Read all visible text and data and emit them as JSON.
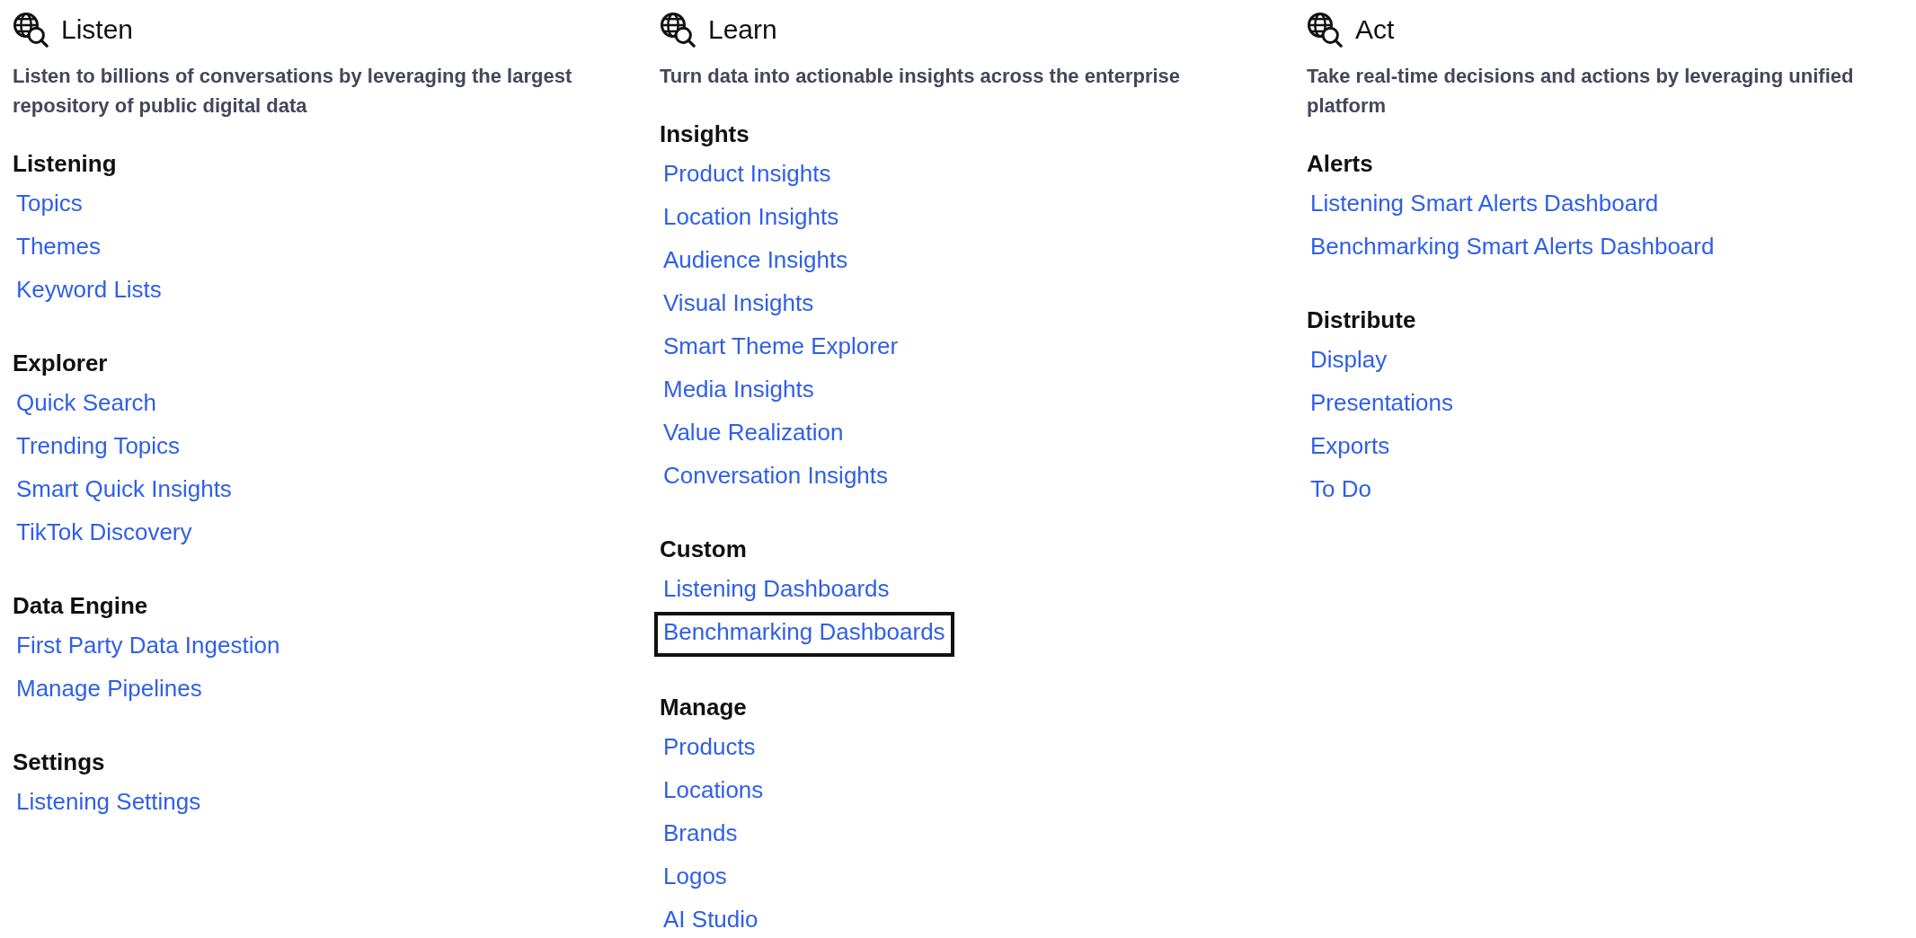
{
  "columns": [
    {
      "title": "Listen",
      "description": "Listen to billions of conversations by leveraging the largest repository of public digital data",
      "sections": [
        {
          "heading": "Listening",
          "links": [
            {
              "label": "Topics",
              "highlighted": false
            },
            {
              "label": "Themes",
              "highlighted": false
            },
            {
              "label": "Keyword Lists",
              "highlighted": false
            }
          ]
        },
        {
          "heading": "Explorer",
          "links": [
            {
              "label": "Quick Search",
              "highlighted": false
            },
            {
              "label": "Trending Topics",
              "highlighted": false
            },
            {
              "label": "Smart Quick Insights",
              "highlighted": false
            },
            {
              "label": "TikTok Discovery",
              "highlighted": false
            }
          ]
        },
        {
          "heading": "Data Engine",
          "links": [
            {
              "label": "First Party Data Ingestion",
              "highlighted": false
            },
            {
              "label": "Manage Pipelines",
              "highlighted": false
            }
          ]
        },
        {
          "heading": "Settings",
          "links": [
            {
              "label": "Listening Settings",
              "highlighted": false
            }
          ]
        }
      ]
    },
    {
      "title": "Learn",
      "description": "Turn data into actionable insights across the enterprise",
      "sections": [
        {
          "heading": "Insights",
          "links": [
            {
              "label": "Product Insights",
              "highlighted": false
            },
            {
              "label": "Location Insights",
              "highlighted": false
            },
            {
              "label": "Audience Insights",
              "highlighted": false
            },
            {
              "label": "Visual Insights",
              "highlighted": false
            },
            {
              "label": "Smart Theme Explorer",
              "highlighted": false
            },
            {
              "label": "Media Insights",
              "highlighted": false
            },
            {
              "label": "Value Realization",
              "highlighted": false
            },
            {
              "label": "Conversation Insights",
              "highlighted": false
            }
          ]
        },
        {
          "heading": "Custom",
          "links": [
            {
              "label": "Listening Dashboards",
              "highlighted": false
            },
            {
              "label": "Benchmarking Dashboards",
              "highlighted": true
            }
          ]
        },
        {
          "heading": "Manage",
          "links": [
            {
              "label": "Products",
              "highlighted": false
            },
            {
              "label": "Locations",
              "highlighted": false
            },
            {
              "label": "Brands",
              "highlighted": false
            },
            {
              "label": "Logos",
              "highlighted": false
            },
            {
              "label": "AI Studio",
              "highlighted": false
            }
          ]
        }
      ]
    },
    {
      "title": "Act",
      "description": "Take real-time decisions and actions by leveraging unified platform",
      "sections": [
        {
          "heading": "Alerts",
          "links": [
            {
              "label": "Listening Smart Alerts Dashboard",
              "highlighted": false
            },
            {
              "label": "Benchmarking Smart Alerts Dashboard",
              "highlighted": false
            }
          ]
        },
        {
          "heading": "Distribute",
          "links": [
            {
              "label": "Display",
              "highlighted": false
            },
            {
              "label": "Presentations",
              "highlighted": false
            },
            {
              "label": "Exports",
              "highlighted": false
            },
            {
              "label": "To Do",
              "highlighted": false
            }
          ]
        }
      ]
    }
  ]
}
